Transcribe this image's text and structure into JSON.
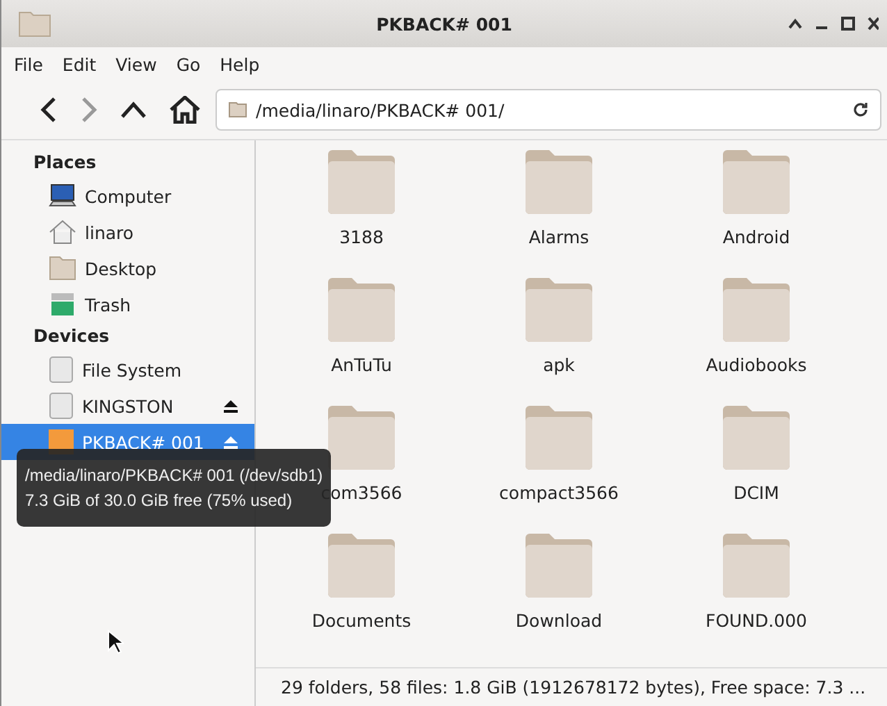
{
  "window": {
    "title": "PKBACK# 001"
  },
  "menu": [
    "File",
    "Edit",
    "View",
    "Go",
    "Help"
  ],
  "location": {
    "value": "/media/linaro/PKBACK# 001/"
  },
  "sidebar": {
    "sections": [
      {
        "title": "Places",
        "items": [
          {
            "label": "Computer",
            "kind": "computer",
            "selected": false,
            "eject": false
          },
          {
            "label": "linaro",
            "kind": "home",
            "selected": false,
            "eject": false
          },
          {
            "label": "Desktop",
            "kind": "desktop",
            "selected": false,
            "eject": false
          },
          {
            "label": "Trash",
            "kind": "trash",
            "selected": false,
            "eject": false
          }
        ]
      },
      {
        "title": "Devices",
        "items": [
          {
            "label": "File System",
            "kind": "drive",
            "selected": false,
            "eject": false
          },
          {
            "label": "KINGSTON",
            "kind": "drive",
            "selected": false,
            "eject": true
          },
          {
            "label": "PKBACK# 001",
            "kind": "usb",
            "selected": true,
            "eject": true
          }
        ]
      }
    ]
  },
  "tooltip": {
    "lines": [
      "/media/linaro/PKBACK# 001 (/dev/sdb1)",
      "7.3 GiB of 30.0 GiB free (75% used)"
    ]
  },
  "files": [
    "3188",
    "Alarms",
    "Android",
    "AnTuTu",
    "apk",
    "Audiobooks",
    "com3566",
    "compact3566",
    "DCIM",
    "Documents",
    "Download",
    "FOUND.000"
  ],
  "status_bar": "29 folders, 58 files: 1.8 GiB (1912678172 bytes), Free space: 7.3 ..."
}
